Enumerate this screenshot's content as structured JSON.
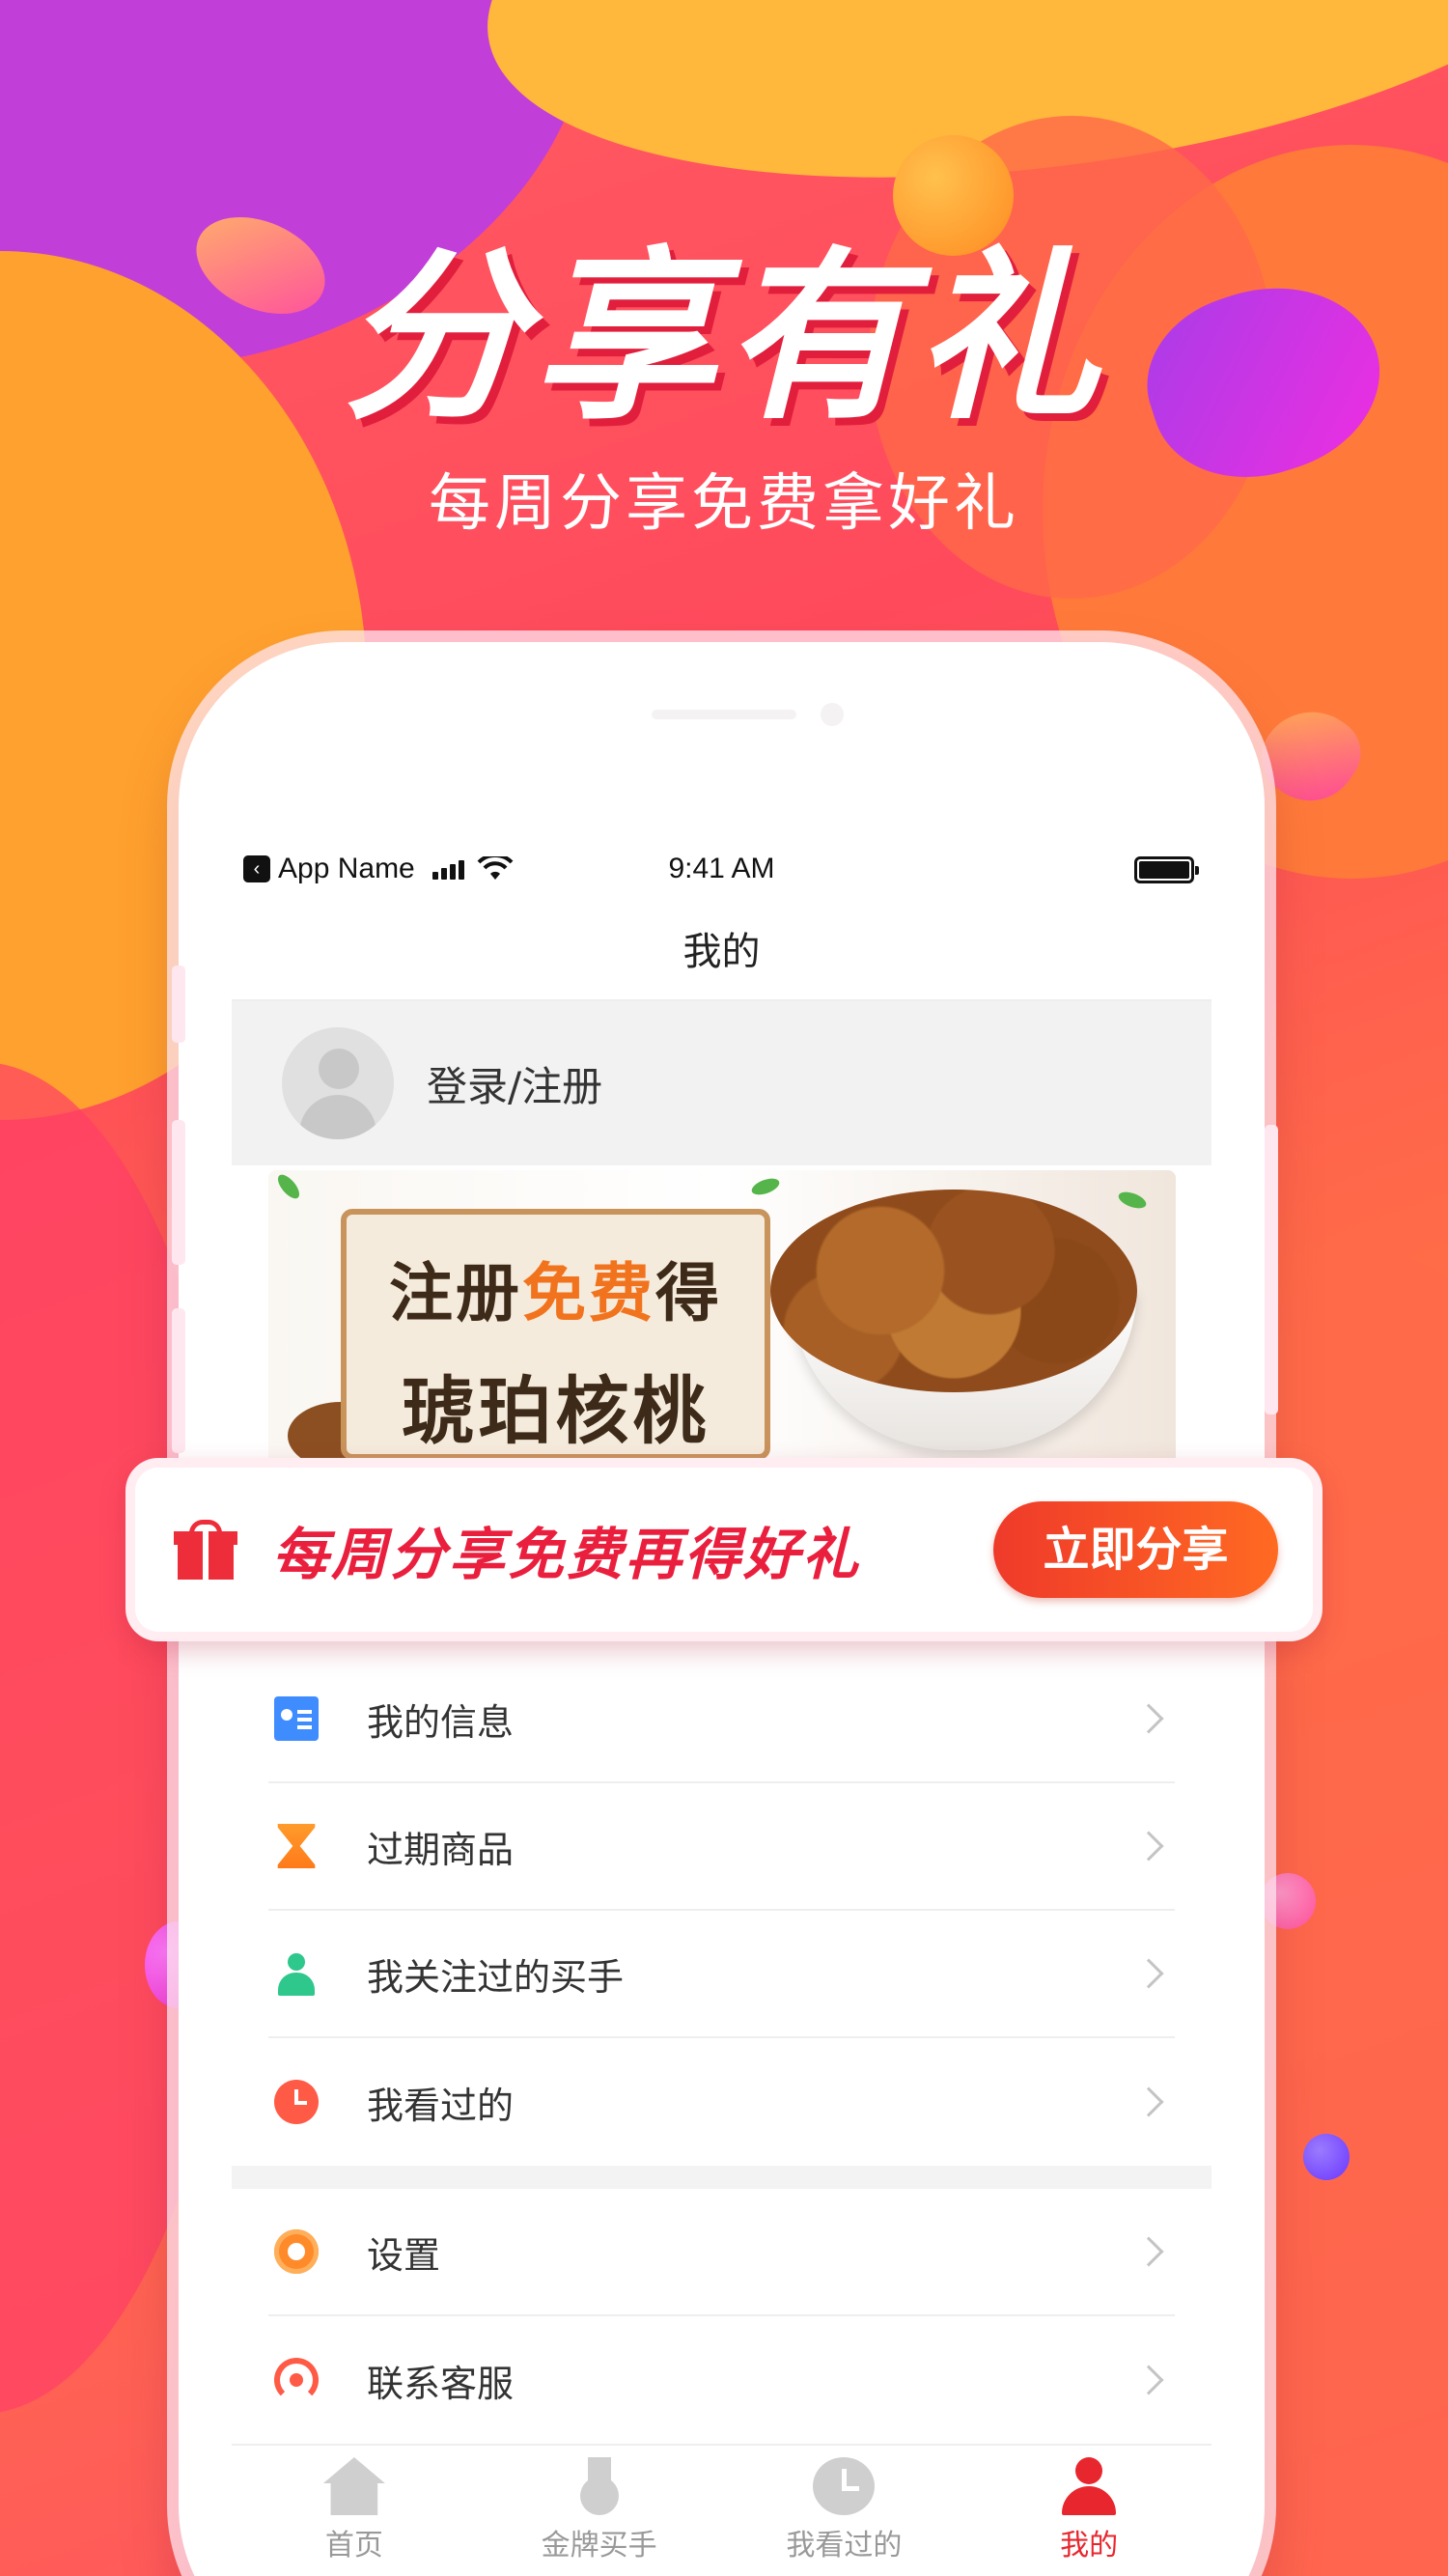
{
  "promo": {
    "title": "分享有礼",
    "subtitle": "每周分享免费拿好礼"
  },
  "status_bar": {
    "app_name": "App Name",
    "time": "9:41 AM"
  },
  "nav": {
    "title": "我的"
  },
  "profile": {
    "login_label": "登录/注册"
  },
  "banner": {
    "line1_prefix": "注册",
    "line1_highlight": "免费",
    "line1_suffix": "得",
    "line2": "琥珀核桃"
  },
  "share_strip": {
    "text": "每周分享免费再得好礼",
    "button_label": "立即分享"
  },
  "menu": {
    "group1": [
      {
        "label": "我的信息",
        "icon": "id-card-icon"
      },
      {
        "label": "过期商品",
        "icon": "hourglass-icon"
      },
      {
        "label": "我关注过的买手",
        "icon": "buyer-icon"
      },
      {
        "label": "我看过的",
        "icon": "clock-icon"
      }
    ],
    "group2": [
      {
        "label": "设置",
        "icon": "gear-icon"
      },
      {
        "label": "联系客服",
        "icon": "support-icon"
      }
    ]
  },
  "tabbar": {
    "tabs": [
      {
        "label": "首页",
        "icon": "home-icon",
        "active": false
      },
      {
        "label": "金牌买手",
        "icon": "medal-icon",
        "active": false
      },
      {
        "label": "我看过的",
        "icon": "history-icon",
        "active": false
      },
      {
        "label": "我的",
        "icon": "user-icon",
        "active": true
      }
    ]
  },
  "colors": {
    "accent": "#e8262e",
    "share_button_start": "#ef3a2a",
    "share_button_end": "#ff6a22"
  }
}
